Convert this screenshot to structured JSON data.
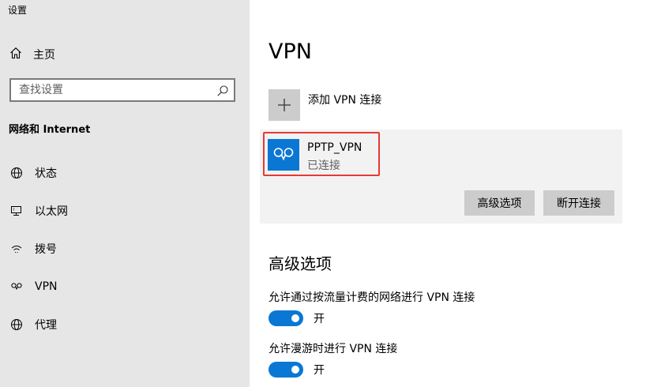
{
  "window": {
    "title": "设置"
  },
  "sidebar": {
    "home_label": "主页",
    "search_placeholder": "查找设置",
    "section_heading": "网络和 Internet",
    "items": [
      {
        "label": "状态",
        "icon": "globe-status-icon"
      },
      {
        "label": "以太网",
        "icon": "ethernet-icon"
      },
      {
        "label": "拨号",
        "icon": "dialup-icon"
      },
      {
        "label": "VPN",
        "icon": "vpn-icon"
      },
      {
        "label": "代理",
        "icon": "proxy-globe-icon"
      }
    ]
  },
  "main": {
    "title": "VPN",
    "add_vpn_label": "添加 VPN 连接",
    "connection": {
      "name": "PPTP_VPN",
      "status": "已连接",
      "advanced_button": "高级选项",
      "disconnect_button": "断开连接"
    },
    "advanced": {
      "heading": "高级选项",
      "settings": [
        {
          "label": "允许通过按流量计费的网络进行 VPN 连接",
          "state": "开",
          "on": true
        },
        {
          "label": "允许漫游时进行 VPN 连接",
          "state": "开",
          "on": true
        }
      ]
    }
  },
  "colors": {
    "accent": "#0a77d4",
    "sidebar_bg": "#e6e6e6",
    "card_bg": "#f2f2f2",
    "highlight_border": "#e53935",
    "button_bg": "#cccccc"
  }
}
